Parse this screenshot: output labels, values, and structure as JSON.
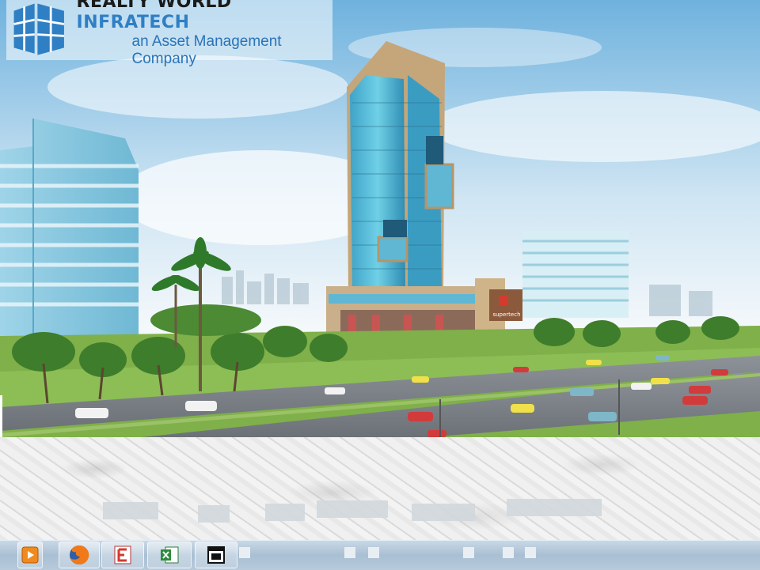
{
  "logo": {
    "brand_word1": "REALTY WORLD",
    "brand_word2": "INFRATECH",
    "tagline": "an Asset Management Company",
    "accent_color": "#2f7fc4"
  },
  "scene": {
    "building_sign": "supertech"
  },
  "taskbar": {
    "items": [
      {
        "icon": "media-player-icon"
      },
      {
        "icon": "firefox-icon"
      },
      {
        "icon": "pdf-editor-icon"
      },
      {
        "icon": "excel-icon"
      },
      {
        "icon": "window-app-icon"
      }
    ]
  }
}
